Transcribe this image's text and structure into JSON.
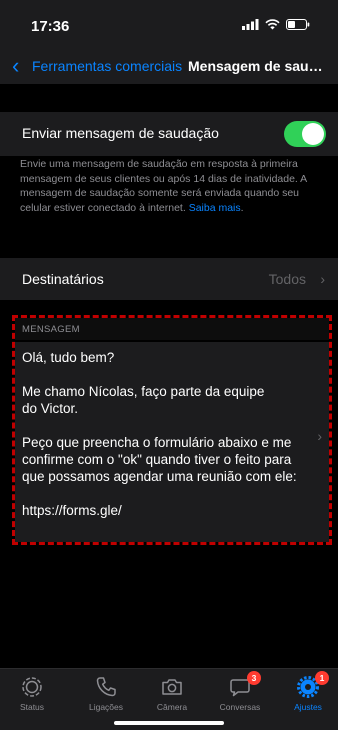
{
  "status": {
    "time": "17:36"
  },
  "nav": {
    "back_label": "Ferramentas comerciais",
    "title": "Mensagem de saudação"
  },
  "greeting": {
    "toggle_label": "Enviar mensagem de saudação",
    "toggle_on": true,
    "description": "Envie uma mensagem de saudação em resposta à primeira mensagem de seus clientes ou após 14 dias de inatividade. A mensagem de saudação somente será enviada quando seu celular estiver conectado à internet.",
    "learn_more": "Saiba mais",
    "learn_more_suffix": "."
  },
  "recipients": {
    "label": "Destinatários",
    "value": "Todos"
  },
  "message": {
    "header": "MENSAGEM",
    "text": "Olá, tudo bem?\n\nMe chamo Nícolas, faço parte da equipe\ndo Victor.\n\nPeço que preencha o formulário abaixo e me confirme com o \"ok\" quando tiver o feito para que possamos agendar uma reunião com ele:\n\nhttps://forms.gle/"
  },
  "tabs": [
    {
      "label": "Status",
      "icon": "status-icon"
    },
    {
      "label": "Ligações",
      "icon": "phone-icon"
    },
    {
      "label": "Câmera",
      "icon": "camera-icon"
    },
    {
      "label": "Conversas",
      "icon": "chat-icon",
      "badge": "3"
    },
    {
      "label": "Ajustes",
      "icon": "settings-icon",
      "badge": "1",
      "active": true
    }
  ],
  "colors": {
    "accent": "#0a84ff",
    "toggle": "#30d158",
    "badge": "#ff3b30",
    "highlight_border": "#c00000"
  }
}
